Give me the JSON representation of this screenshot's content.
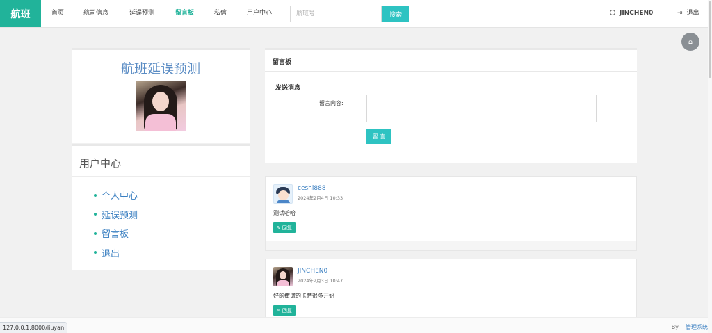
{
  "brand": "航班",
  "nav": {
    "items": [
      "首页",
      "航司信息",
      "延误预测",
      "留言板",
      "私信",
      "用户中心"
    ],
    "active": "留言板",
    "search_placeholder": "航班号",
    "search_button": "搜索",
    "user_name": "JINCHEN0",
    "logout": "退出"
  },
  "profile": {
    "title": "航班延误预测"
  },
  "user_center": {
    "title": "用户中心",
    "links": [
      "个人中心",
      "延误预测",
      "留言板",
      "退出"
    ]
  },
  "board": {
    "header": "留言板",
    "send_title": "发送消息",
    "content_label": "留言内容:",
    "submit": "留 言"
  },
  "comments": [
    {
      "name": "ceshi888",
      "time": "2024年2月4日 10:33",
      "text": "测试哈哈",
      "reply": "回复",
      "avatar": "cartoon"
    },
    {
      "name": "JINCHEN0",
      "time": "2024年2月3日 10:47",
      "text": "好的撒谎的卡萨很多开始",
      "reply": "回复",
      "avatar": "photo"
    }
  ],
  "status_url": "127.0.0.1:8000/liuyan",
  "footer": {
    "by": "By:",
    "link": "管理系统"
  },
  "colors": {
    "brand": "#21b39a",
    "button": "#2ec3c2",
    "link": "#3a7fc1"
  }
}
